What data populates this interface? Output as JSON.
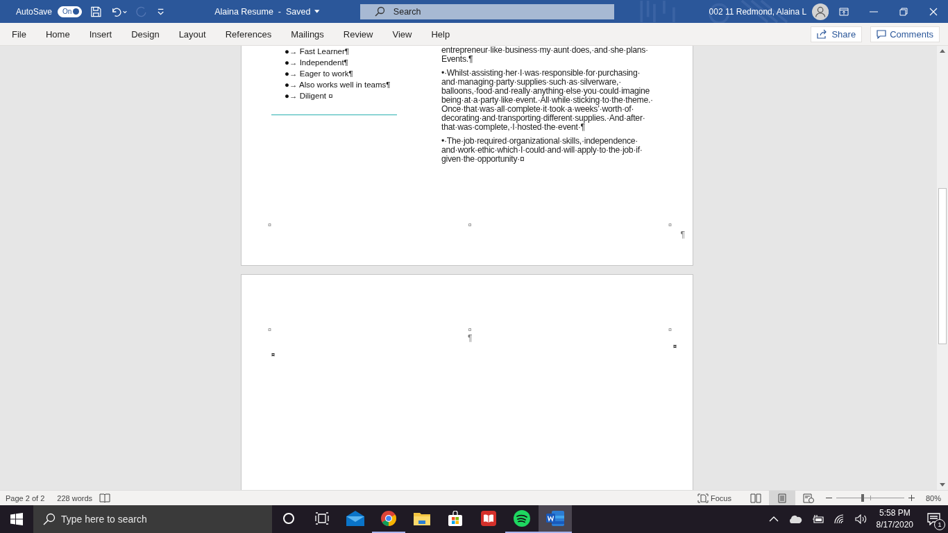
{
  "title_bar": {
    "autosave": {
      "label": "AutoSave",
      "toggle": "On",
      "on": true
    },
    "document_title": "Alaina Resume  -  Saved",
    "search": {
      "placeholder": "Search"
    },
    "user_name": "002 11 Redmond, Alaina L"
  },
  "menu_tabs": [
    {
      "label": "File",
      "selected": false
    },
    {
      "label": "Home",
      "selected": false
    },
    {
      "label": "Insert",
      "selected": false
    },
    {
      "label": "Design",
      "selected": false
    },
    {
      "label": "Layout",
      "selected": false
    },
    {
      "label": "References",
      "selected": false
    },
    {
      "label": "Mailings",
      "selected": false
    },
    {
      "label": "Review",
      "selected": false
    },
    {
      "label": "View",
      "selected": false
    },
    {
      "label": "Help",
      "selected": false
    }
  ],
  "share_button": "Share",
  "comments_button": "Comments",
  "document": {
    "page_1": {
      "skills": [
        "●→ Fast Learner¶",
        "●→ Independent¶",
        "●→ Eager to work¶",
        "●→ Also works well in teams¶",
        "●→ Diligent ¤"
      ],
      "paragraphs": [
        "entrepreneur·like·business·my·aunt·does,·and·she·plans· Events.¶",
        "•·Whilst·assisting·her·I·was·responsible·for·purchasing· and·managing·party·supplies·such·as·silverware,· balloons,·food·and·really·anything·else·you·could·imagine being·at·a·party·like·event.·All·while·sticking·to·the·theme.· Once·that·was·all·complete·it·took·a·weeks’·worth·of· decorating·and·transporting·different·supplies.·And·after· that·was·complete,·I·hosted·the·event·¶",
        "•·The·job·required·organizational·skills,·independence· and·work·ethic·which·I·could·and·will·apply·to·the·job·if· given·the·opportunity·¤"
      ],
      "cell_marks": [
        "¤",
        "¤",
        "¤"
      ],
      "end_mark": "¶"
    },
    "page_2": {
      "cell_marks": [
        "¤",
        "¤",
        "¤"
      ],
      "paragraph_mark": "¶",
      "row_mark": "¤",
      "end_mark": "¤"
    }
  },
  "status_bar": {
    "page": "Page 2 of 2",
    "words": "228 words",
    "focus": "Focus",
    "views": [
      {
        "kind": "read",
        "selected": false
      },
      {
        "kind": "print",
        "selected": true
      },
      {
        "kind": "web",
        "selected": false
      }
    ],
    "zoom": {
      "level": 0.39,
      "reading": "80%"
    }
  },
  "taskbar": {
    "search": {
      "placeholder": "Type here to search"
    },
    "apps": [
      {
        "kind": "cortana",
        "open": false,
        "active": false
      },
      {
        "kind": "taskview",
        "open": false,
        "active": false
      },
      {
        "kind": "mail",
        "open": false,
        "active": false
      },
      {
        "kind": "chrome",
        "open": true,
        "active": false
      },
      {
        "kind": "explorer",
        "open": false,
        "active": false
      },
      {
        "kind": "store",
        "open": false,
        "active": false
      },
      {
        "kind": "reader",
        "open": false,
        "active": false
      },
      {
        "kind": "spotify",
        "open": true,
        "active": false
      },
      {
        "kind": "word",
        "open": true,
        "active": true
      }
    ],
    "time": "5:58 PM",
    "date": "8/17/2020",
    "notifications": "1"
  }
}
